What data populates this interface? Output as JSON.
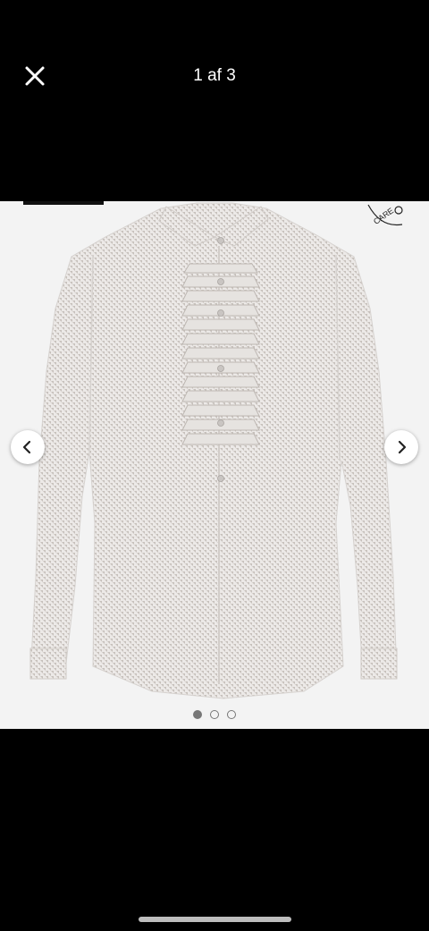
{
  "header": {
    "counter": "1 af 3",
    "close_icon": "close-icon"
  },
  "gallery": {
    "prev_icon": "chevron-left-icon",
    "next_icon": "chevron-right-icon",
    "total_slides": 3,
    "active_slide": 1,
    "badge_text": "CARE",
    "image_description_colors": {
      "background": "#f3f3f3",
      "shirt": "#e9e7e5",
      "pattern": "#b9b4b0"
    }
  }
}
